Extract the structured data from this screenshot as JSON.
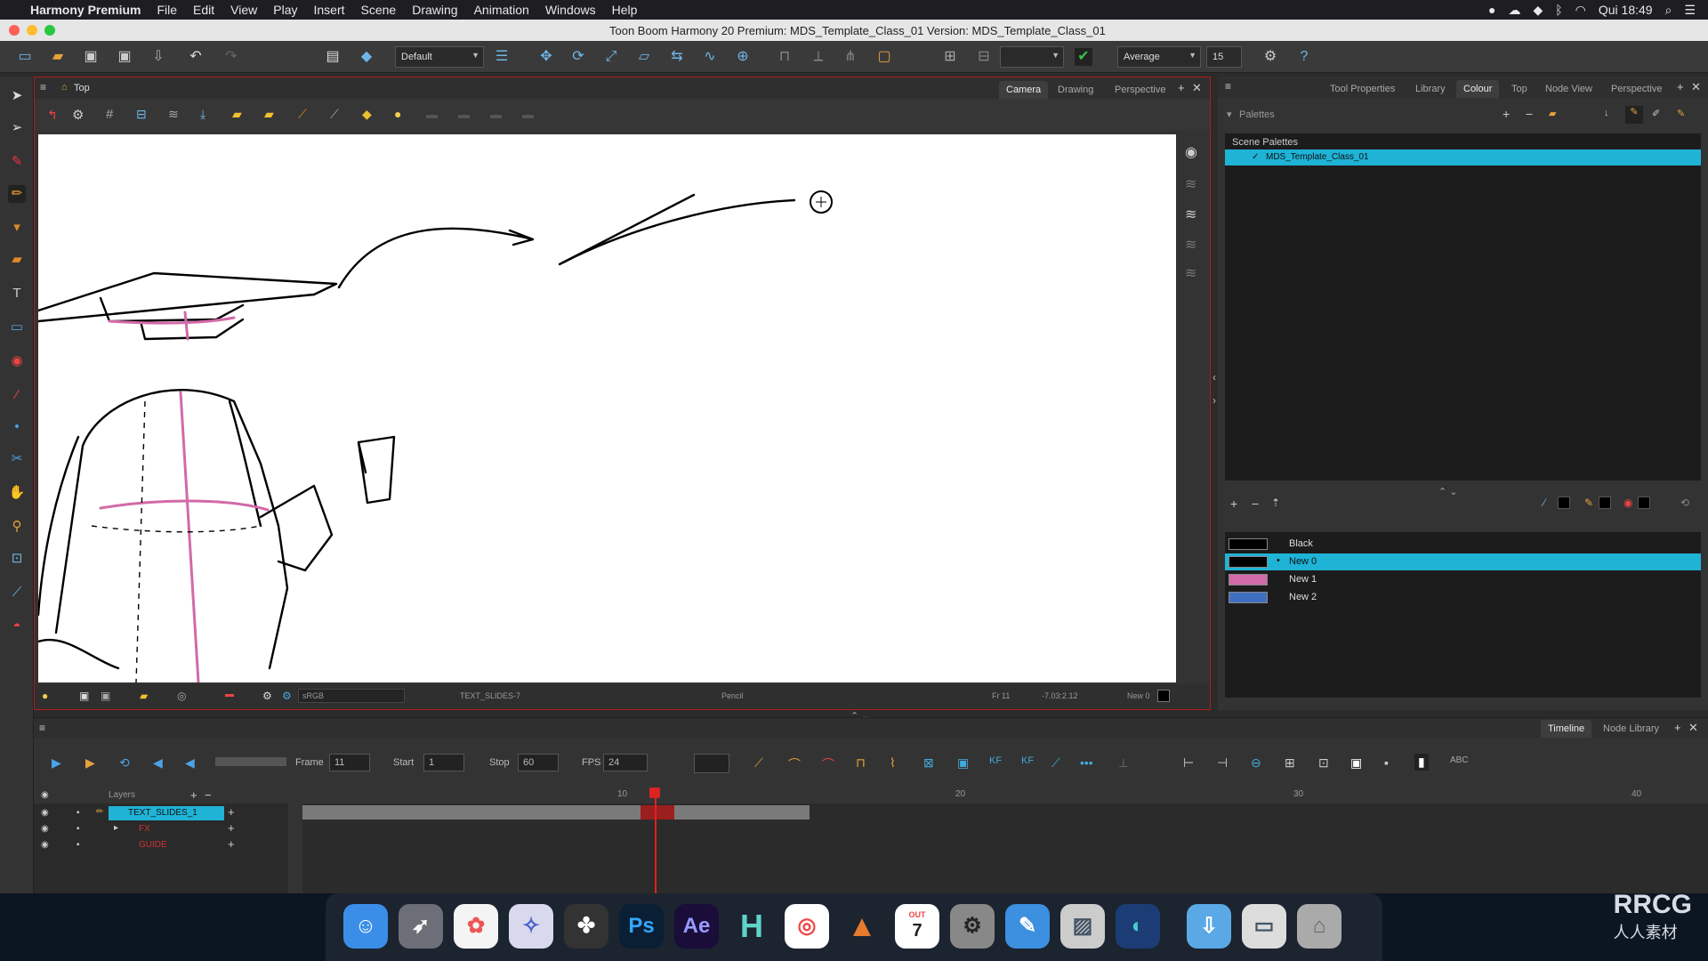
{
  "menubar": {
    "app_name": "Harmony Premium",
    "items": [
      "File",
      "Edit",
      "View",
      "Play",
      "Insert",
      "Scene",
      "Drawing",
      "Animation",
      "Windows",
      "Help"
    ],
    "clock": "Qui 18:49"
  },
  "window": {
    "title": "Toon Boom Harmony 20 Premium: MDS_Template_Class_01 Version: MDS_Template_Class_01"
  },
  "toolbar": {
    "workspace_combo": "Default",
    "smoothing_combo": "Average",
    "smoothing_value": "15"
  },
  "camera_view": {
    "breadcrumb": "Top",
    "tabs": [
      "Camera",
      "Drawing",
      "Perspective"
    ],
    "active_tab": "Camera",
    "status": {
      "color_space": "sRGB",
      "layer": "TEXT_SLIDES-7",
      "tool": "Pencil",
      "frame": "Fr 11",
      "coords": "-7.03:2.12",
      "color": "New 0"
    }
  },
  "right_panel": {
    "tabs": [
      "Tool Properties",
      "Library",
      "Colour",
      "Top",
      "Node View",
      "Perspective"
    ],
    "active_tab": "Colour",
    "palettes_label": "Palettes",
    "scene_palettes_header": "Scene Palettes",
    "palette_name": "MDS_Template_Class_01",
    "colours": [
      {
        "name": "Black",
        "hex": "#000000"
      },
      {
        "name": "New 0",
        "hex": "#000000"
      },
      {
        "name": "New 1",
        "hex": "#d26aa8"
      },
      {
        "name": "New 2",
        "hex": "#3f6fbf"
      }
    ],
    "selected_colour": "New 0"
  },
  "timeline": {
    "tabs": [
      "Timeline",
      "Node Library"
    ],
    "active_tab": "Timeline",
    "frame_label": "Frame",
    "frame_value": "11",
    "start_label": "Start",
    "start_value": "1",
    "stop_label": "Stop",
    "stop_value": "60",
    "fps_label": "FPS",
    "fps_value": "24",
    "layers_header": "Layers",
    "layers": [
      "TEXT_SLIDES_1",
      "FX",
      "GUIDE"
    ],
    "ruler_marks": [
      "10",
      "20",
      "30",
      "40"
    ],
    "current_frame": 11
  },
  "dock": {
    "apps": [
      "Finder",
      "Launchpad",
      "Photos",
      "Safari",
      "DaVinci",
      "Ps",
      "Ae",
      "H",
      "Chrome",
      "Affinity",
      "Calendar",
      "Settings",
      "Sketch",
      "Preview",
      "Edge",
      "Downloads",
      "Messages",
      "Trash"
    ],
    "calendar_month": "OUT",
    "calendar_day": "7"
  },
  "watermark": {
    "brand": "RRCG",
    "sub": "人人素材"
  }
}
